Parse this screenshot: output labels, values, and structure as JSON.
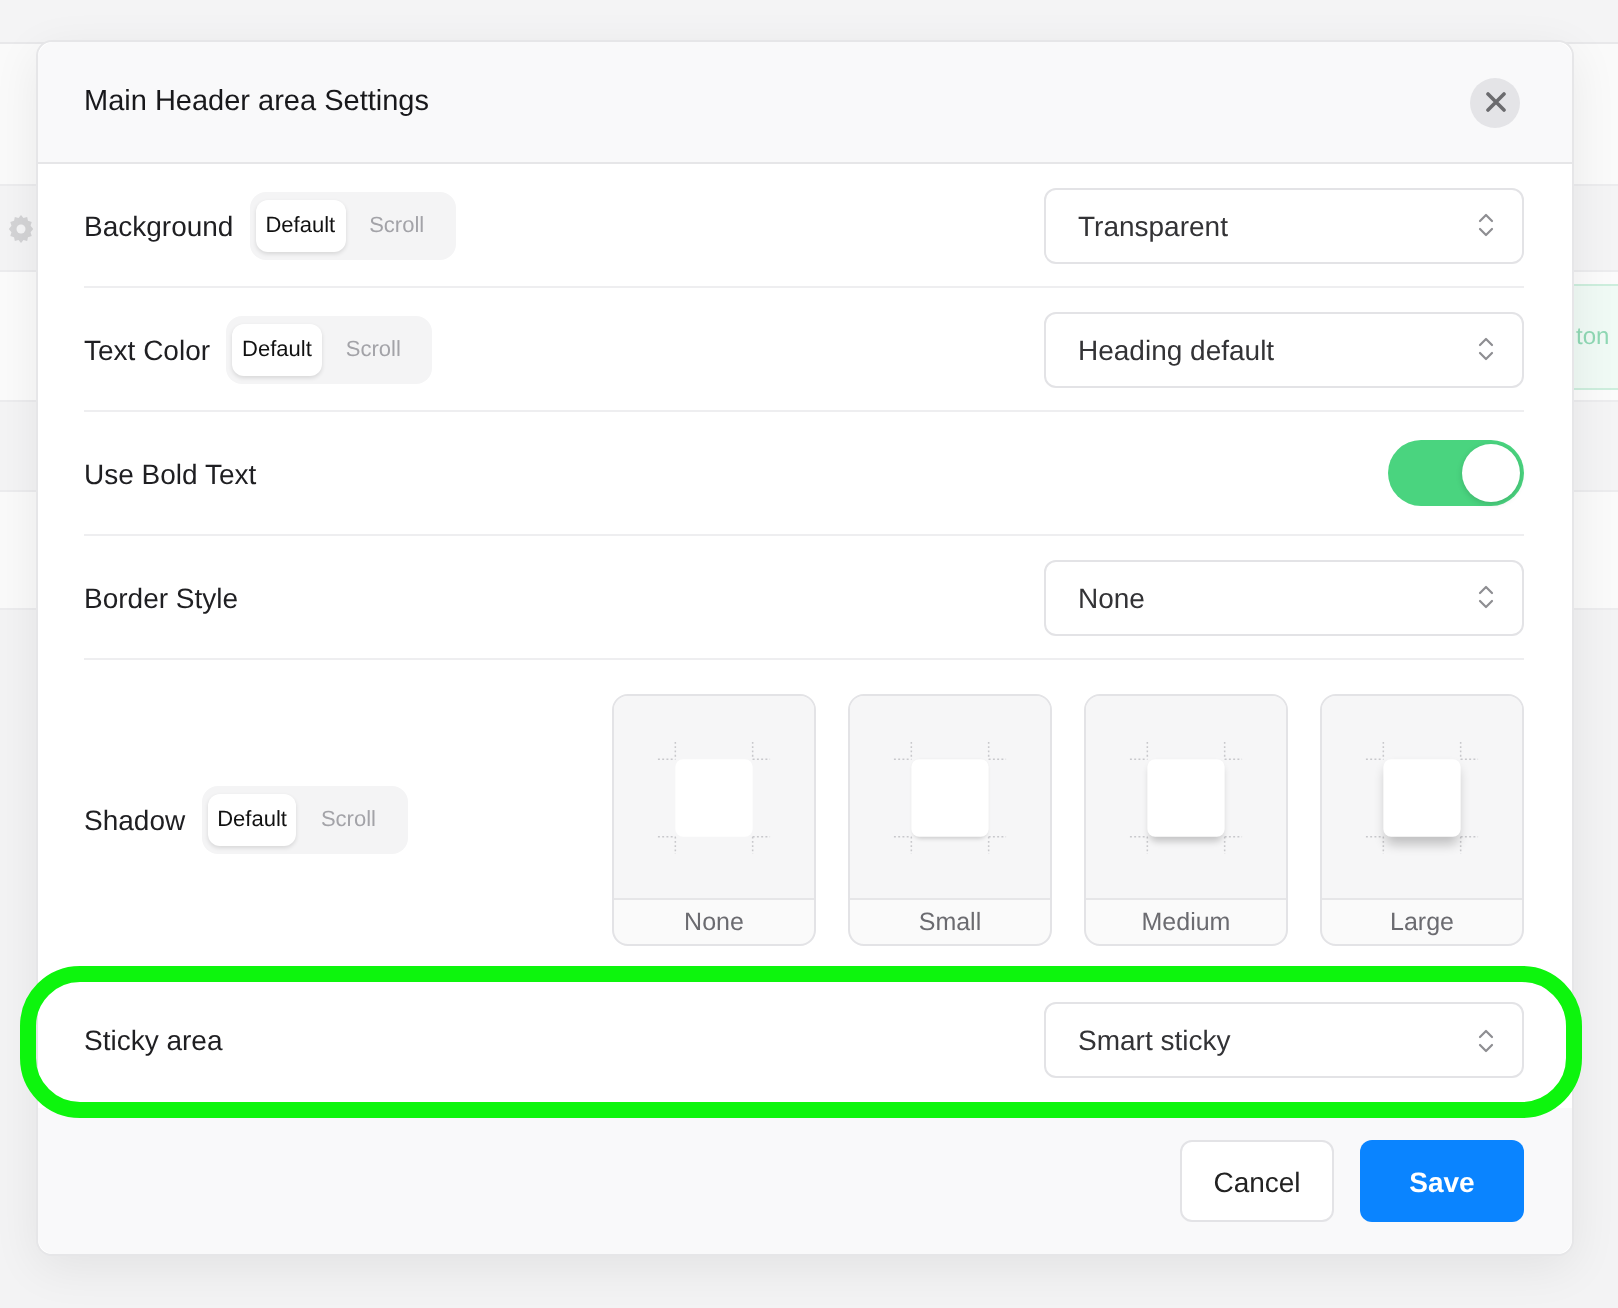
{
  "background": {
    "button_text": "ton"
  },
  "dialog": {
    "title": "Main Header area Settings",
    "rows": [
      {
        "kind": "select",
        "label": "Background",
        "modes": [
          {
            "label": "Default",
            "selected": true
          },
          {
            "label": "Scroll",
            "selected": false
          }
        ],
        "value": "Transparent"
      },
      {
        "kind": "select",
        "label": "Text Color",
        "modes": [
          {
            "label": "Default",
            "selected": true
          },
          {
            "label": "Scroll",
            "selected": false
          }
        ],
        "value": "Heading default"
      },
      {
        "kind": "toggle",
        "label": "Use Bold Text",
        "on": true
      },
      {
        "kind": "select",
        "label": "Border Style",
        "value": "None"
      },
      {
        "kind": "shadow",
        "label": "Shadow",
        "modes": [
          {
            "label": "Default",
            "selected": true
          },
          {
            "label": "Scroll",
            "selected": false
          }
        ],
        "options": [
          {
            "label": "None",
            "selected": false
          },
          {
            "label": "Small",
            "selected": false
          },
          {
            "label": "Medium",
            "selected": false
          },
          {
            "label": "Large",
            "selected": false
          }
        ]
      },
      {
        "kind": "select",
        "label": "Sticky area",
        "value": "Smart sticky",
        "highlighted": true
      }
    ],
    "buttons": [
      {
        "label": "Cancel",
        "kind": "secondary"
      },
      {
        "label": "Save",
        "kind": "primary"
      }
    ]
  }
}
